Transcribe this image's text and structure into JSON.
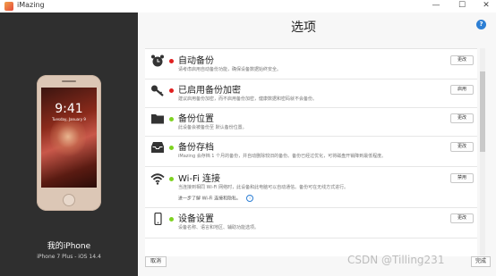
{
  "window": {
    "title": "iMazing",
    "controls": [
      "—",
      "☐",
      "✕"
    ]
  },
  "device": {
    "name": "我的iPhone",
    "model": "iPhone 7 Plus - iOS 14.4",
    "lock_time": "9:41",
    "lock_date": "Tuesday, January 9"
  },
  "page": {
    "title": "选项"
  },
  "options": [
    {
      "icon": "alarm-clock-icon",
      "status_color": "#e02020",
      "title": "自动备份",
      "description": "请考虑启用自动备份功能，确保设备数据始终安全。",
      "button": "更改"
    },
    {
      "icon": "key-icon",
      "status_color": "#e02020",
      "title": "已启用备份加密",
      "description": "建议启用备份加密，而不启用备份加密，健康数据和密码就不会备份。",
      "button": "启用"
    },
    {
      "icon": "folder-icon",
      "status_color": "#7ed321",
      "title": "备份位置",
      "description": "此设备会被备份至 默认备份位置。",
      "button": "更改"
    },
    {
      "icon": "archive-tray-icon",
      "status_color": "#7ed321",
      "title": "备份存档",
      "description": "iMazing 会存档 1 个月的备份，并自动删除较旧的备份。备份已经过优化，可将磁盘开销降到最低程度。",
      "button": "更改"
    },
    {
      "icon": "wifi-icon",
      "status_color": "#7ed321",
      "title": "Wi-Fi 连接",
      "description": "当连接到相同 Wi-Fi 网络时，此设备和此电脑可以自动通信。备份可在无线方式进行。",
      "link": "进一步了解 Wi-Fi 连接和隐私。",
      "button": "禁用"
    },
    {
      "icon": "phone-device-icon",
      "status_color": "#7ed321",
      "title": "设备设置",
      "description": "设备名称、语言和地区、辅助功能选项。",
      "button": "更改"
    }
  ],
  "footer": {
    "cancel": "取消",
    "done": "完成"
  },
  "watermark": "CSDN @Tilling231"
}
